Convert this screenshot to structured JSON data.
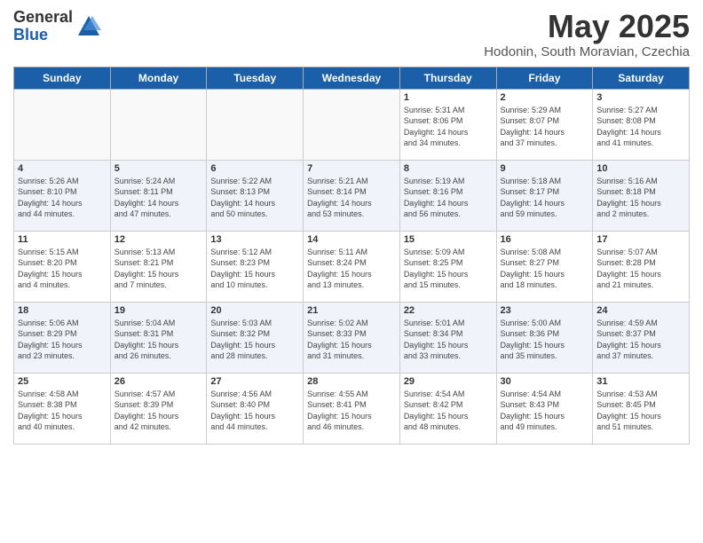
{
  "logo": {
    "general": "General",
    "blue": "Blue"
  },
  "title": "May 2025",
  "location": "Hodonin, South Moravian, Czechia",
  "headers": [
    "Sunday",
    "Monday",
    "Tuesday",
    "Wednesday",
    "Thursday",
    "Friday",
    "Saturday"
  ],
  "weeks": [
    [
      {
        "day": "",
        "info": ""
      },
      {
        "day": "",
        "info": ""
      },
      {
        "day": "",
        "info": ""
      },
      {
        "day": "",
        "info": ""
      },
      {
        "day": "1",
        "info": "Sunrise: 5:31 AM\nSunset: 8:06 PM\nDaylight: 14 hours\nand 34 minutes."
      },
      {
        "day": "2",
        "info": "Sunrise: 5:29 AM\nSunset: 8:07 PM\nDaylight: 14 hours\nand 37 minutes."
      },
      {
        "day": "3",
        "info": "Sunrise: 5:27 AM\nSunset: 8:08 PM\nDaylight: 14 hours\nand 41 minutes."
      }
    ],
    [
      {
        "day": "4",
        "info": "Sunrise: 5:26 AM\nSunset: 8:10 PM\nDaylight: 14 hours\nand 44 minutes."
      },
      {
        "day": "5",
        "info": "Sunrise: 5:24 AM\nSunset: 8:11 PM\nDaylight: 14 hours\nand 47 minutes."
      },
      {
        "day": "6",
        "info": "Sunrise: 5:22 AM\nSunset: 8:13 PM\nDaylight: 14 hours\nand 50 minutes."
      },
      {
        "day": "7",
        "info": "Sunrise: 5:21 AM\nSunset: 8:14 PM\nDaylight: 14 hours\nand 53 minutes."
      },
      {
        "day": "8",
        "info": "Sunrise: 5:19 AM\nSunset: 8:16 PM\nDaylight: 14 hours\nand 56 minutes."
      },
      {
        "day": "9",
        "info": "Sunrise: 5:18 AM\nSunset: 8:17 PM\nDaylight: 14 hours\nand 59 minutes."
      },
      {
        "day": "10",
        "info": "Sunrise: 5:16 AM\nSunset: 8:18 PM\nDaylight: 15 hours\nand 2 minutes."
      }
    ],
    [
      {
        "day": "11",
        "info": "Sunrise: 5:15 AM\nSunset: 8:20 PM\nDaylight: 15 hours\nand 4 minutes."
      },
      {
        "day": "12",
        "info": "Sunrise: 5:13 AM\nSunset: 8:21 PM\nDaylight: 15 hours\nand 7 minutes."
      },
      {
        "day": "13",
        "info": "Sunrise: 5:12 AM\nSunset: 8:23 PM\nDaylight: 15 hours\nand 10 minutes."
      },
      {
        "day": "14",
        "info": "Sunrise: 5:11 AM\nSunset: 8:24 PM\nDaylight: 15 hours\nand 13 minutes."
      },
      {
        "day": "15",
        "info": "Sunrise: 5:09 AM\nSunset: 8:25 PM\nDaylight: 15 hours\nand 15 minutes."
      },
      {
        "day": "16",
        "info": "Sunrise: 5:08 AM\nSunset: 8:27 PM\nDaylight: 15 hours\nand 18 minutes."
      },
      {
        "day": "17",
        "info": "Sunrise: 5:07 AM\nSunset: 8:28 PM\nDaylight: 15 hours\nand 21 minutes."
      }
    ],
    [
      {
        "day": "18",
        "info": "Sunrise: 5:06 AM\nSunset: 8:29 PM\nDaylight: 15 hours\nand 23 minutes."
      },
      {
        "day": "19",
        "info": "Sunrise: 5:04 AM\nSunset: 8:31 PM\nDaylight: 15 hours\nand 26 minutes."
      },
      {
        "day": "20",
        "info": "Sunrise: 5:03 AM\nSunset: 8:32 PM\nDaylight: 15 hours\nand 28 minutes."
      },
      {
        "day": "21",
        "info": "Sunrise: 5:02 AM\nSunset: 8:33 PM\nDaylight: 15 hours\nand 31 minutes."
      },
      {
        "day": "22",
        "info": "Sunrise: 5:01 AM\nSunset: 8:34 PM\nDaylight: 15 hours\nand 33 minutes."
      },
      {
        "day": "23",
        "info": "Sunrise: 5:00 AM\nSunset: 8:36 PM\nDaylight: 15 hours\nand 35 minutes."
      },
      {
        "day": "24",
        "info": "Sunrise: 4:59 AM\nSunset: 8:37 PM\nDaylight: 15 hours\nand 37 minutes."
      }
    ],
    [
      {
        "day": "25",
        "info": "Sunrise: 4:58 AM\nSunset: 8:38 PM\nDaylight: 15 hours\nand 40 minutes."
      },
      {
        "day": "26",
        "info": "Sunrise: 4:57 AM\nSunset: 8:39 PM\nDaylight: 15 hours\nand 42 minutes."
      },
      {
        "day": "27",
        "info": "Sunrise: 4:56 AM\nSunset: 8:40 PM\nDaylight: 15 hours\nand 44 minutes."
      },
      {
        "day": "28",
        "info": "Sunrise: 4:55 AM\nSunset: 8:41 PM\nDaylight: 15 hours\nand 46 minutes."
      },
      {
        "day": "29",
        "info": "Sunrise: 4:54 AM\nSunset: 8:42 PM\nDaylight: 15 hours\nand 48 minutes."
      },
      {
        "day": "30",
        "info": "Sunrise: 4:54 AM\nSunset: 8:43 PM\nDaylight: 15 hours\nand 49 minutes."
      },
      {
        "day": "31",
        "info": "Sunrise: 4:53 AM\nSunset: 8:45 PM\nDaylight: 15 hours\nand 51 minutes."
      }
    ]
  ]
}
